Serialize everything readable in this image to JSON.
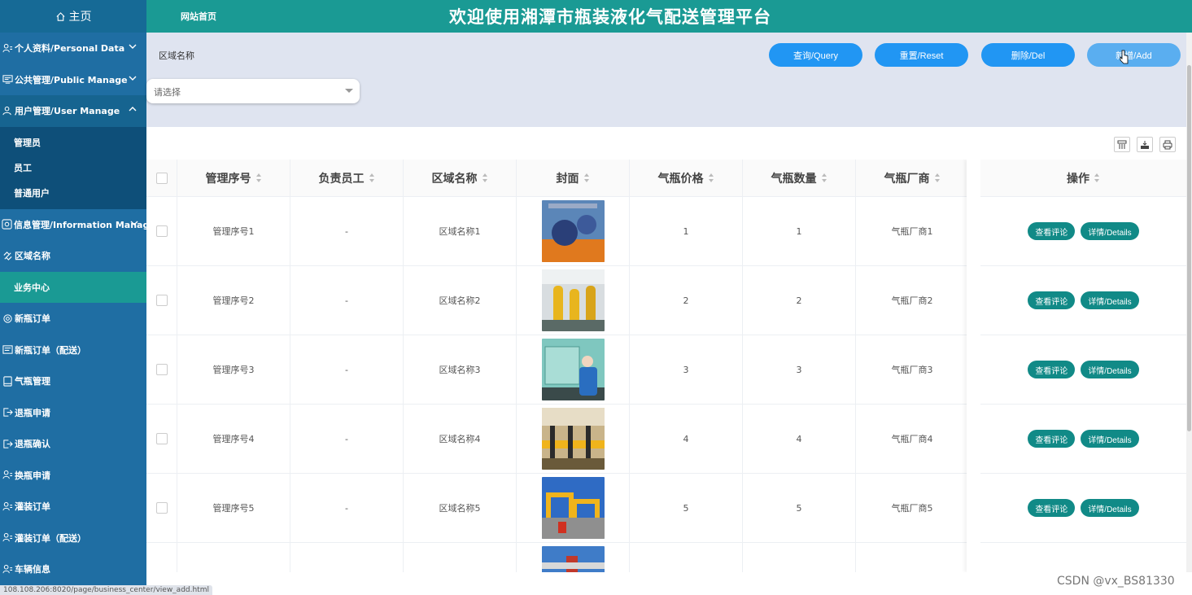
{
  "header": {
    "home_label": "主页",
    "site_home": "网站首页",
    "title": "欢迎使用湘潭市瓶装液化气配送管理平台"
  },
  "sidebar": {
    "items": [
      {
        "label": "个人资料/Personal Data",
        "icon": "user-icon",
        "chevron": "down"
      },
      {
        "label": "公共管理/Public Manage",
        "icon": "monitor-icon",
        "chevron": "down"
      },
      {
        "label": "用户管理/User Manage",
        "icon": "user-icon",
        "chevron": "up"
      },
      {
        "label": "信息管理/Information Manage",
        "icon": "info-icon",
        "chevron": "down"
      },
      {
        "label": "区域名称",
        "icon": "link-icon"
      },
      {
        "label": "业务中心"
      },
      {
        "label": "新瓶订单",
        "icon": "gear-icon"
      },
      {
        "label": "新瓶订单（配送）",
        "icon": "list-icon"
      },
      {
        "label": "气瓶管理",
        "icon": "tablet-icon"
      },
      {
        "label": "退瓶申请",
        "icon": "exit-icon"
      },
      {
        "label": "退瓶确认",
        "icon": "exit-icon"
      },
      {
        "label": "换瓶申请",
        "icon": "user-icon"
      },
      {
        "label": "灌装订单",
        "icon": "user-icon"
      },
      {
        "label": "灌装订单（配送）",
        "icon": "user-icon"
      },
      {
        "label": "车辆信息",
        "icon": "user-icon"
      }
    ],
    "sub_items": [
      "管理员",
      "员工",
      "普通用户"
    ]
  },
  "filter": {
    "label": "区域名称",
    "select_placeholder": "请选择",
    "buttons": {
      "query": "查询/Query",
      "reset": "重置/Reset",
      "delete": "删除/Del",
      "add": "新增/Add"
    }
  },
  "table": {
    "columns": [
      "管理序号",
      "负责员工",
      "区域名称",
      "封面",
      "气瓶价格",
      "气瓶数量",
      "气瓶厂商",
      "操作"
    ],
    "rows": [
      {
        "seq": "管理序号1",
        "staff": "-",
        "area": "区域名称1",
        "price": "1",
        "qty": "1",
        "maker": "气瓶厂商1"
      },
      {
        "seq": "管理序号2",
        "staff": "-",
        "area": "区域名称2",
        "price": "2",
        "qty": "2",
        "maker": "气瓶厂商2"
      },
      {
        "seq": "管理序号3",
        "staff": "-",
        "area": "区域名称3",
        "price": "3",
        "qty": "3",
        "maker": "气瓶厂商3"
      },
      {
        "seq": "管理序号4",
        "staff": "-",
        "area": "区域名称4",
        "price": "4",
        "qty": "4",
        "maker": "气瓶厂商4"
      },
      {
        "seq": "管理序号5",
        "staff": "-",
        "area": "区域名称5",
        "price": "5",
        "qty": "5",
        "maker": "气瓶厂商5"
      }
    ],
    "op_comment": "查看评论",
    "op_details": "详情/Details"
  },
  "status_url": "108.108.206:8020/page/business_center/view_add.html",
  "watermark": "CSDN @vx_BS81330",
  "colors": {
    "header_teal": "#1a9a94",
    "sidebar_blue": "#1f6ea3",
    "button_blue": "#2196f3",
    "op_teal": "#118a87",
    "filter_bg": "#dfe4f0"
  }
}
